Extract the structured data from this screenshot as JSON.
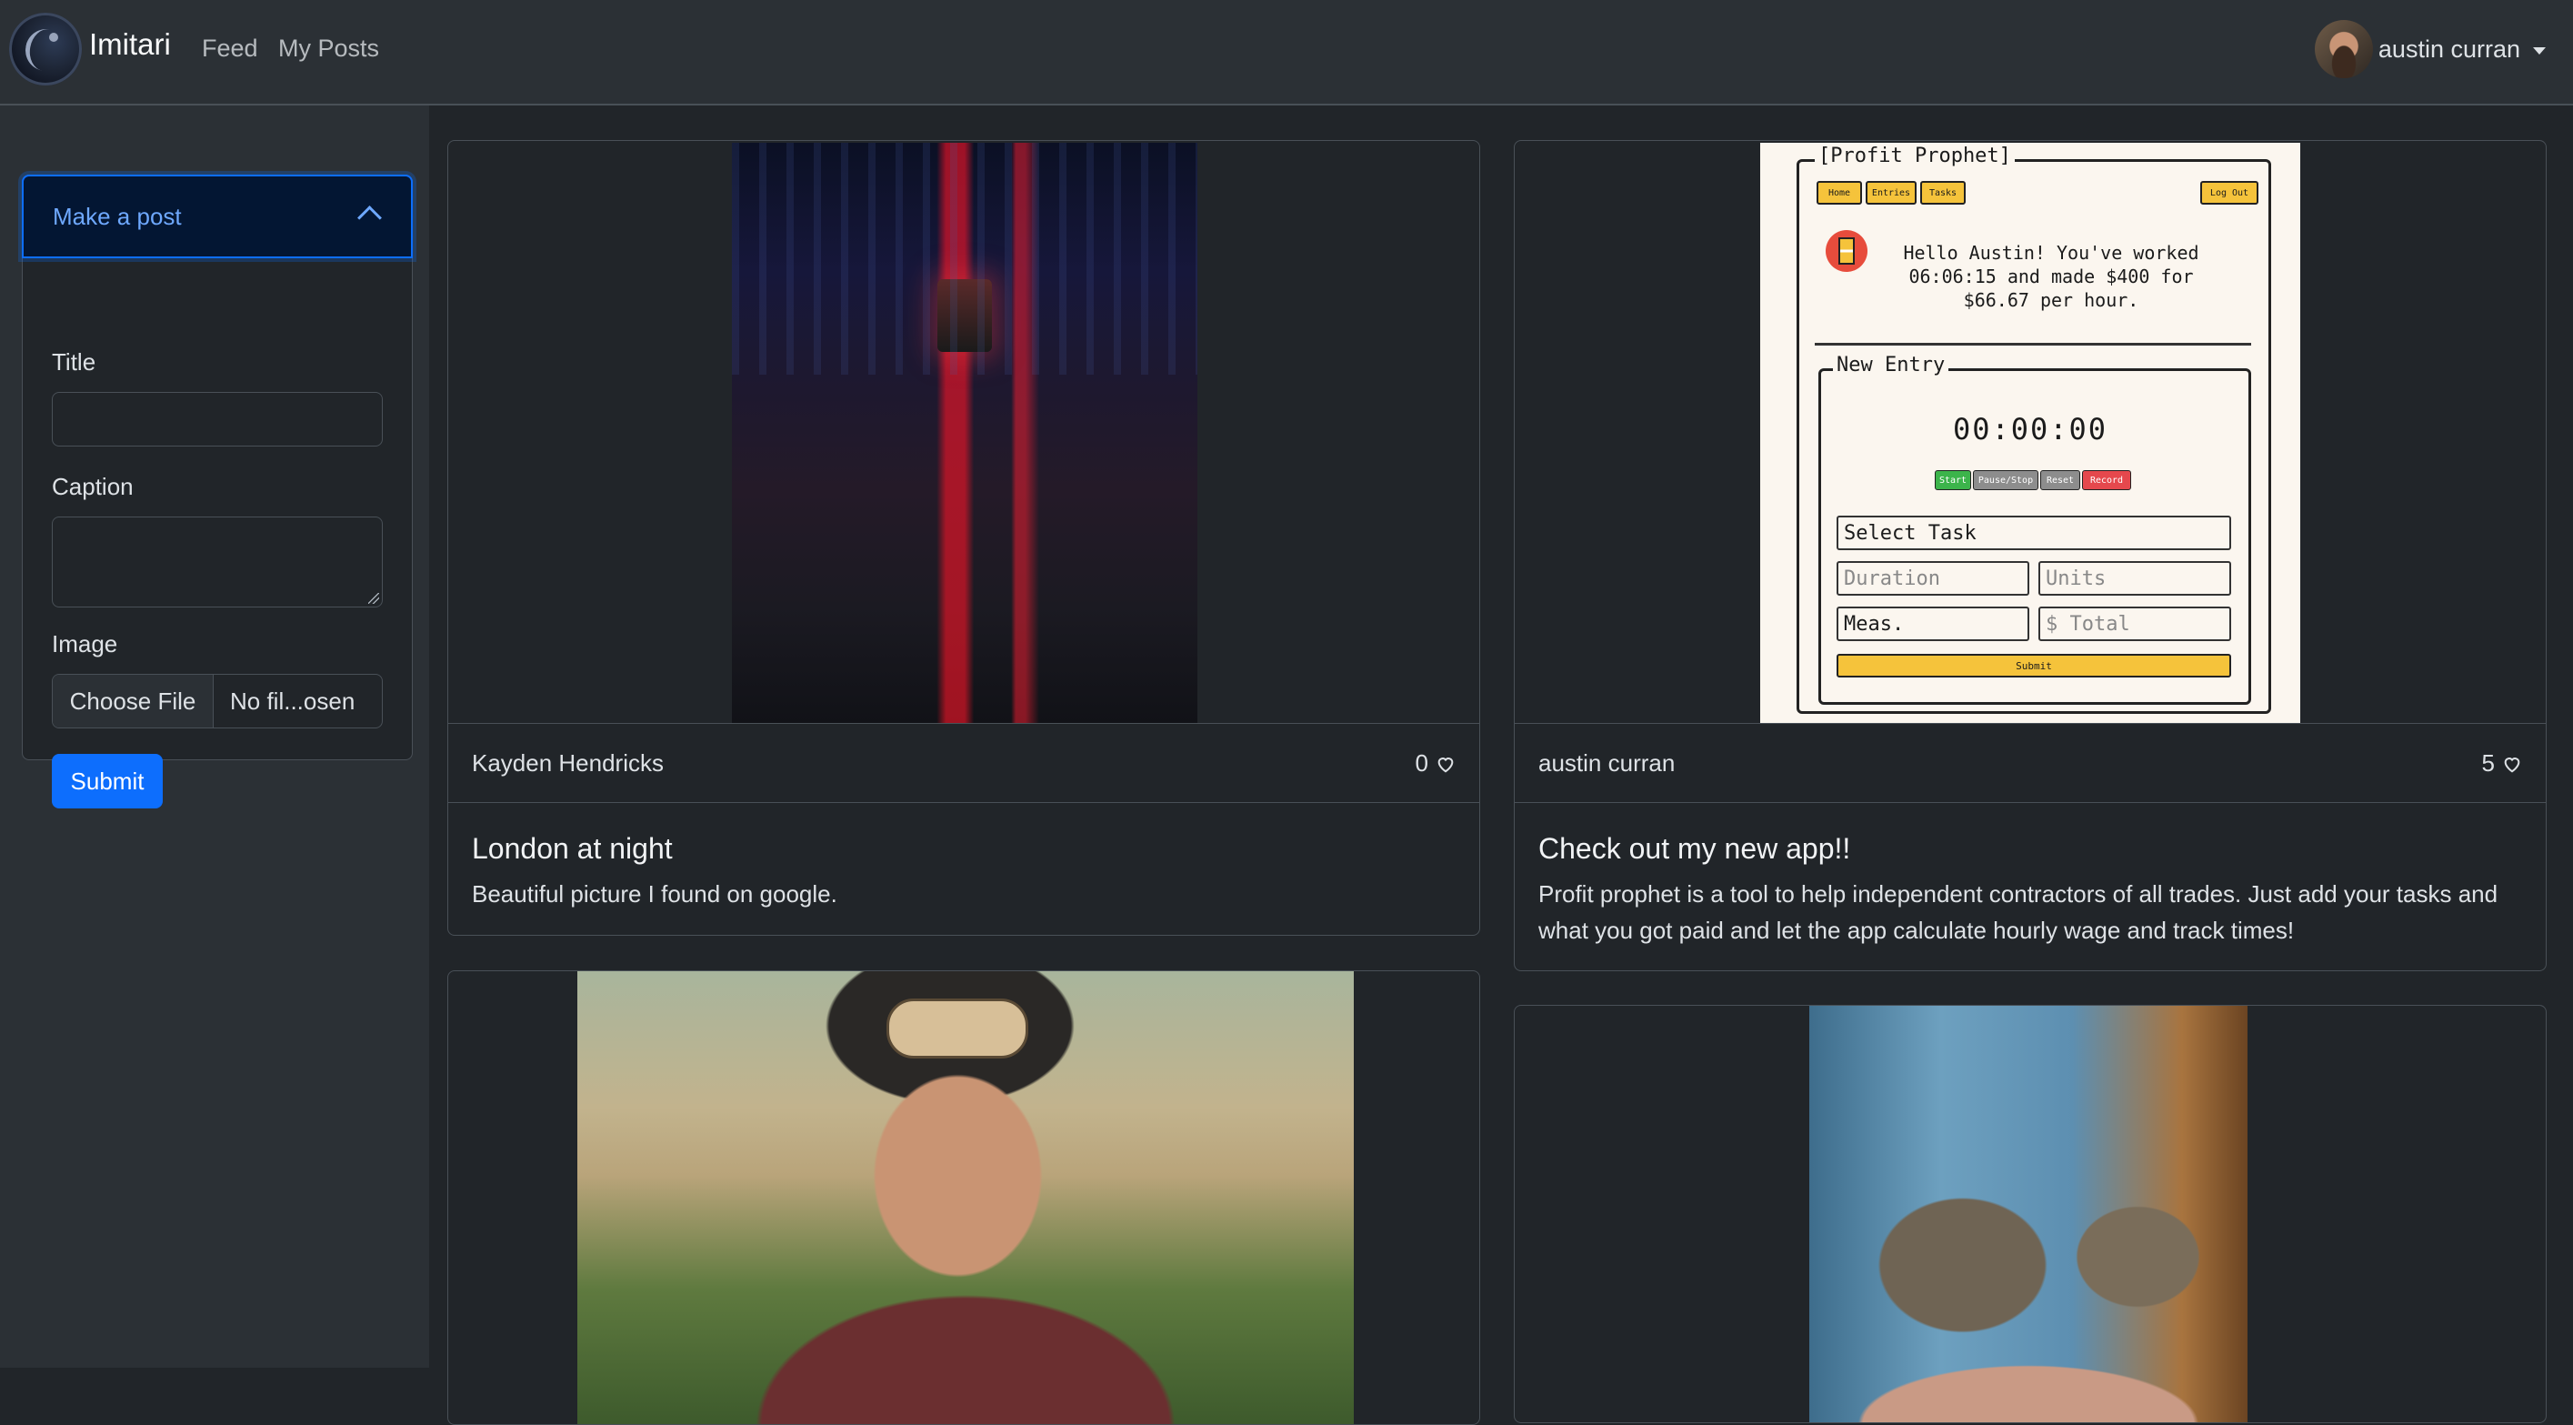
{
  "navbar": {
    "brand": "Imitari",
    "links": [
      "Feed",
      "My Posts"
    ],
    "user_name": "austin curran"
  },
  "sidebar": {
    "accordion_title": "Make a post",
    "title_label": "Title",
    "caption_label": "Caption",
    "image_label": "Image",
    "file_button": "Choose File",
    "file_status": "No fil...osen",
    "submit_label": "Submit"
  },
  "posts": [
    {
      "author": "Kayden Hendricks",
      "likes": "0",
      "title": "London at night",
      "caption": "Beautiful picture I found on google."
    },
    {
      "author": "austin curran",
      "likes": "5",
      "title": "Check out my new app!!",
      "caption": "Profit prophet is a tool to help independent contractors of all trades. Just add your tasks and what you got paid and let the app calculate hourly wage and track times!",
      "screenshot": {
        "app_title": "[Profit Prophet]",
        "nav": [
          "Home",
          "Entries",
          "Tasks"
        ],
        "logout": "Log Out",
        "greeting": "Hello Austin! You've worked 06:06:15 and made $400 for $66.67 per hour.",
        "entry_legend": "New Entry",
        "timer": "00:00:00",
        "controls": [
          "Start",
          "Pause/Stop",
          "Reset",
          "Record"
        ],
        "select_task": "Select Task",
        "duration_ph": "Duration",
        "units_ph": "Units",
        "meas": "Meas.",
        "total_ph": "$ Total",
        "submit": "Submit"
      }
    }
  ],
  "colors": {
    "background": "#212529",
    "panel": "#2b3035",
    "border": "#495057",
    "primary": "#0d6efd",
    "app_yellow": "#f5c33b"
  }
}
